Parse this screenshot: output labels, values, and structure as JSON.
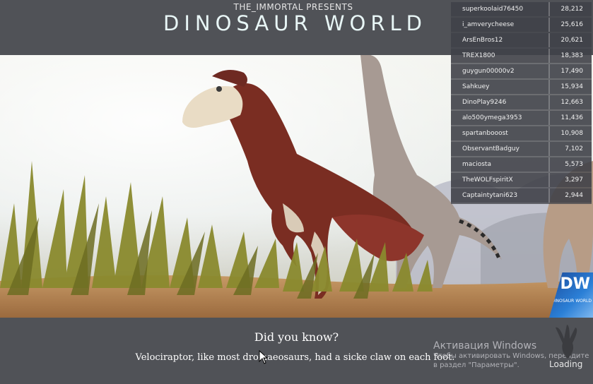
{
  "header": {
    "presenter": "THE_IMMORTAL PRESENTS",
    "title": "DINOSAUR WORLD"
  },
  "leaderboard": [
    {
      "name": "superkoolaid76450",
      "score": "28,212"
    },
    {
      "name": "i_amverycheese",
      "score": "25,616"
    },
    {
      "name": "ArsEnBros12",
      "score": "20,621"
    },
    {
      "name": "TREX1800",
      "score": "18,383"
    },
    {
      "name": "guygun00000v2",
      "score": "17,490"
    },
    {
      "name": "Sahkuey",
      "score": "15,934"
    },
    {
      "name": "DinoPlay9246",
      "score": "12,663"
    },
    {
      "name": "alo500ymega3953",
      "score": "11,436"
    },
    {
      "name": "spartanbooost",
      "score": "10,908"
    },
    {
      "name": "ObservantBadguy",
      "score": "7,102"
    },
    {
      "name": "maciosta",
      "score": "5,573"
    },
    {
      "name": "TheWOLFspiritX",
      "score": "3,297"
    },
    {
      "name": "Captaintytani623",
      "score": "2,944"
    }
  ],
  "fact": {
    "heading": "Did you know?",
    "text": "Velociraptor, like most dromaeosaurs, had a sicke claw on each foot."
  },
  "watermark": {
    "title": "Активация Windows",
    "subtitle": "Чтобы активировать Windows, перейдите в раздел \"Параметры\"."
  },
  "status": {
    "loading": "Loading"
  },
  "logo": {
    "initials": "DW",
    "name": "DINOSAUR WORLD"
  },
  "colors": {
    "bar": "#505257",
    "title": "#e8f6f6",
    "logo": "#2b7fd6"
  }
}
